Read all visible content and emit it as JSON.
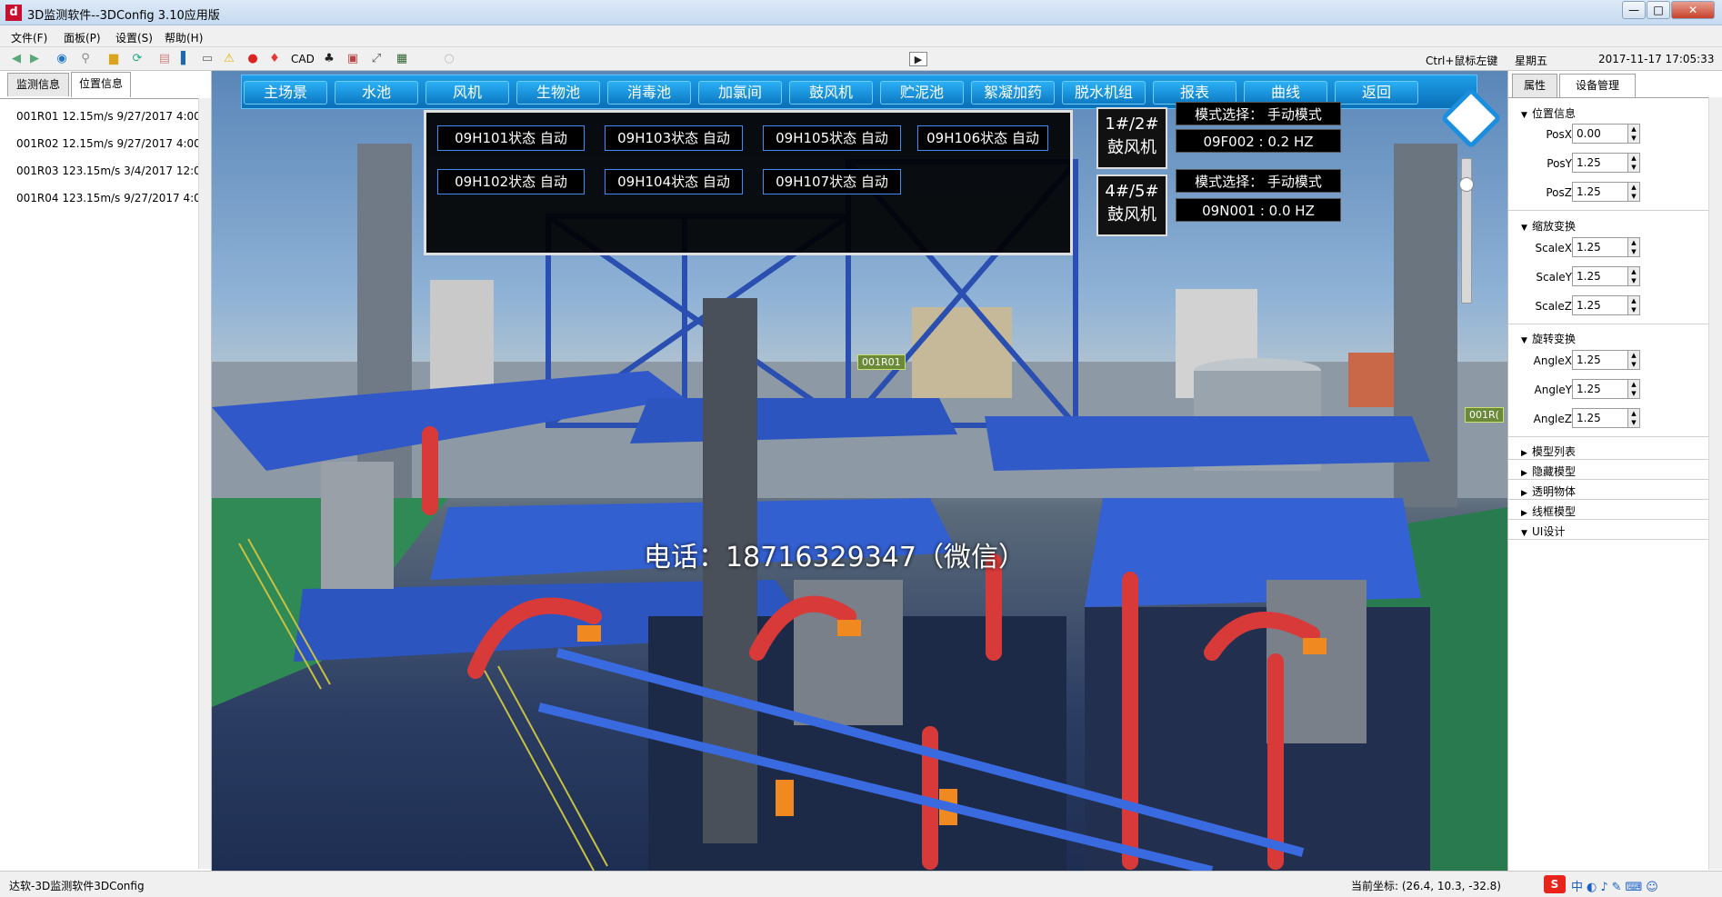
{
  "window": {
    "title": "3D监测软件--3DConfig 3.10应用版",
    "app_icon": "d",
    "controls": [
      "—",
      "□",
      "✕"
    ]
  },
  "menu": [
    "文件(F)",
    "面板(P)",
    "设置(S)",
    "帮助(H)"
  ],
  "toolbar": {
    "cad_label": "CAD",
    "hint": "Ctrl+鼠标左键",
    "weekday": "星期五",
    "datetime": "2017-11-17 17:05:33"
  },
  "left_panel": {
    "tabs": [
      "监测信息",
      "位置信息"
    ],
    "active_tab": 1,
    "items": [
      "001R01   12.15m/s  9/27/2017 4:00",
      "001R02   12.15m/s  9/27/2017 4:00",
      "001R03   123.15m/s  3/4/2017 12:0",
      "001R04   123.15m/s  9/27/2017 4:0"
    ]
  },
  "nav": [
    "主场景",
    "水池",
    "风机",
    "生物池",
    "消毒池",
    "加氯间",
    "鼓风机",
    "贮泥池",
    "絮凝加药",
    "脱水机组",
    "报表",
    "曲线",
    "返回"
  ],
  "status_buttons": {
    "row1": [
      "09H101状态 自动",
      "09H103状态 自动",
      "09H105状态 自动",
      "09H106状态 自动"
    ],
    "row2": [
      "09H102状态 自动",
      "09H104状态 自动",
      "09H107状态 自动"
    ]
  },
  "blowers": [
    {
      "name_line1": "1#/2#",
      "name_line2": "鼓风机",
      "mode": "模式选择： 手动模式",
      "freq": "09F002 :  0.2  HZ"
    },
    {
      "name_line1": "4#/5#",
      "name_line2": "鼓风机",
      "mode": "模式选择： 手动模式",
      "freq": "09N001 :  0.0  HZ"
    }
  ],
  "scene_tags": [
    "001R01",
    "001R("
  ],
  "watermark": "电话：18716329347（微信）",
  "right_panel": {
    "tabs": [
      "属性",
      "设备管理"
    ],
    "active_tab": 1,
    "sections": {
      "position": "位置信息",
      "scale": "缩放变换",
      "rotate": "旋转变换",
      "model_list": "模型列表",
      "hidden_model": "隐藏模型",
      "transparent": "透明物体",
      "wireframe": "线框模型",
      "ui_design": "UI设计"
    },
    "position": [
      {
        "label": "PosX",
        "value": "0.00"
      },
      {
        "label": "PosY",
        "value": "1.25"
      },
      {
        "label": "PosZ",
        "value": "1.25"
      }
    ],
    "scale": [
      {
        "label": "ScaleX",
        "value": "1.25"
      },
      {
        "label": "ScaleY",
        "value": "1.25"
      },
      {
        "label": "ScaleZ",
        "value": "1.25"
      }
    ],
    "rotate": [
      {
        "label": "AngleX",
        "value": "1.25"
      },
      {
        "label": "AngleY",
        "value": "1.25"
      },
      {
        "label": "AngleZ",
        "value": "1.25"
      }
    ]
  },
  "statusbar": {
    "left": "达软-3D监测软件3DConfig",
    "coords": "当前坐标: (26.4, 10.3, -32.8)"
  },
  "colors": {
    "nav_blue": "#0a8fe0",
    "structure_blue": "#2a4fb0",
    "pipe_red": "#d83a3a",
    "button_border": "#3d8ef0"
  }
}
